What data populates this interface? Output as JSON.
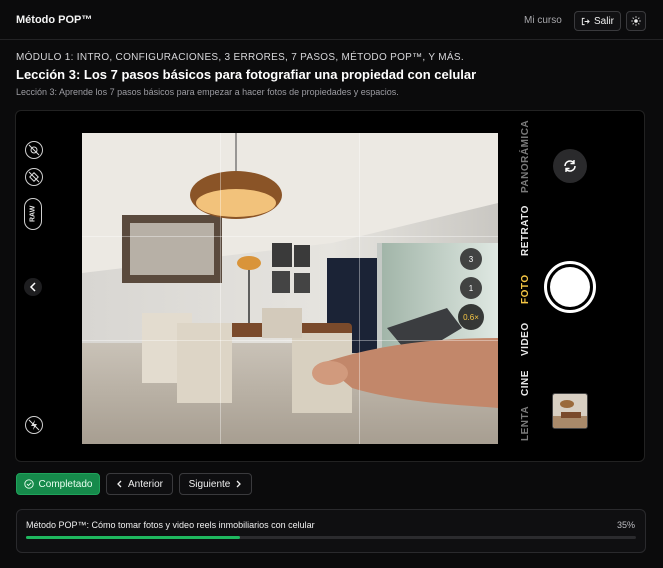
{
  "app": {
    "brand": "Método POP™"
  },
  "nav": {
    "my_course": "Mi curso",
    "logout": "Salir",
    "theme_toggle_icon": "sun-icon"
  },
  "lesson": {
    "module": "MÓDULO 1: INTRO, CONFIGURACIONES, 3 ERRORES, 7 PASOS, MÉTODO POP™, Y MÁS.",
    "title": "Lección 3: Los 7 pasos básicos para fotografiar una propiedad con celular",
    "subtitle": "Lección 3: Aprende los 7 pasos básicos para empezar a hacer fotos de propiedades y espacios."
  },
  "camera": {
    "raw_label": "RAW",
    "modes": [
      "PANORÁMICA",
      "RETRATO",
      "FOTO",
      "VIDEO",
      "CINE",
      "LENTA"
    ],
    "active_mode": "FOTO",
    "zoom_levels": [
      "3",
      "1",
      "0.6×"
    ],
    "active_zoom": "0.6×",
    "accent_color": "#f6c744"
  },
  "actions": {
    "completed": "Completado",
    "previous": "Anterior",
    "next": "Siguiente"
  },
  "course_progress": {
    "title": "Método POP™: Cómo tomar fotos y video reels inmobiliarios con celular",
    "percent_label": "35%",
    "percent": 35,
    "color": "#1fb85f"
  }
}
